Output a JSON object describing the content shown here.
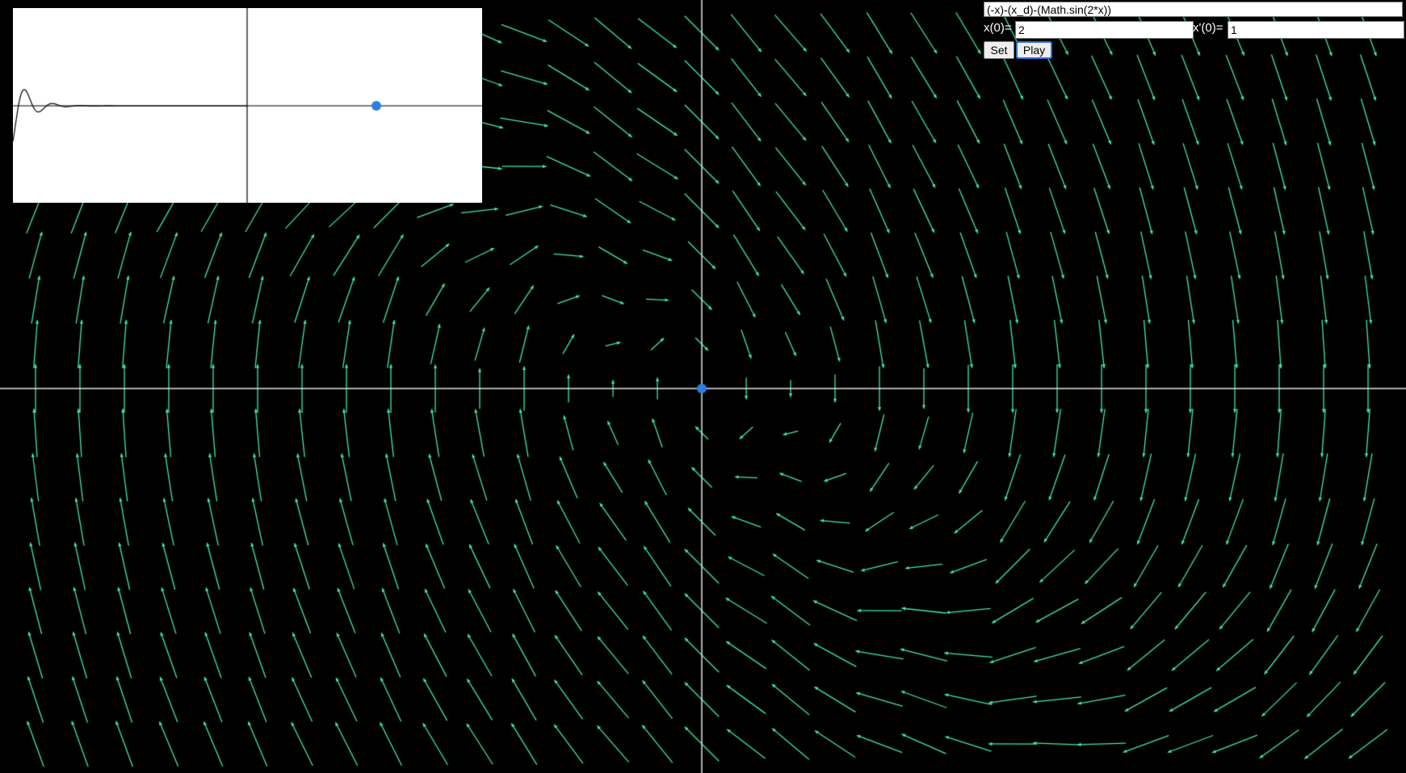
{
  "expression": "(-x)-(x_d)-(Math.sin(2*x))",
  "controls": {
    "x0_label": "x(0)=",
    "x0_value": "2",
    "v0_label": "x'(0)=",
    "v0_value": "1",
    "set_label": "Set",
    "play_label": "Play"
  },
  "colors": {
    "background": "#000000",
    "field_arrow": "#3fe8b0",
    "axis": "#e6e6e6",
    "marker": "#2b7de0",
    "inset_background": "#ffffff",
    "inset_curve": "#000000"
  }
}
